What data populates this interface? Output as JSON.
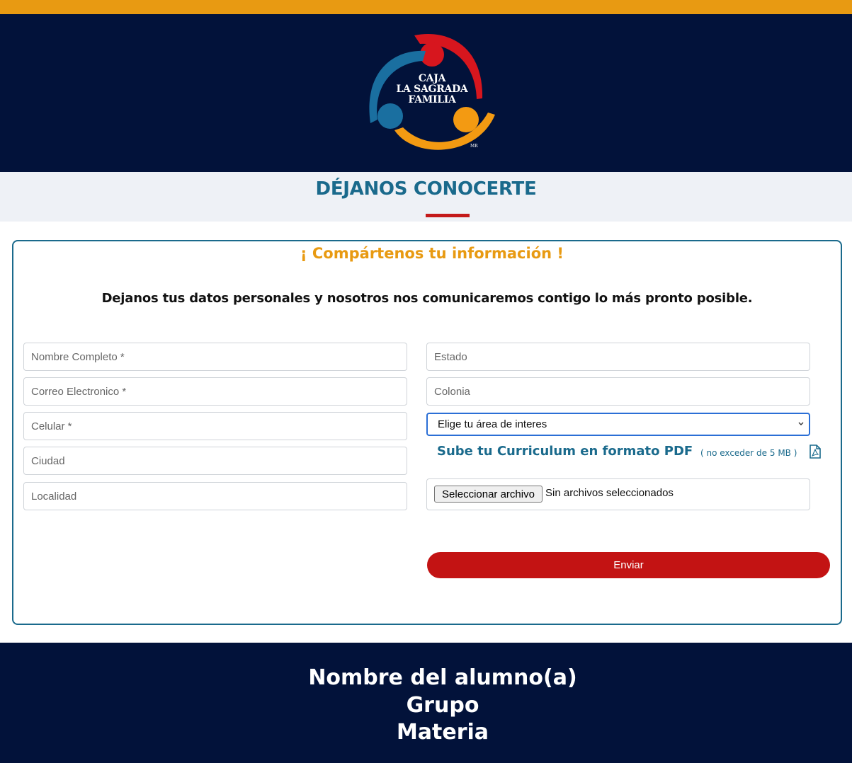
{
  "header": {
    "logo_lines": [
      "CAJA",
      "LA SAGRADA",
      "FAMILIA"
    ],
    "logo_mark": "MR",
    "colors": {
      "top_bar": "#e89a12",
      "navy": "#02123a",
      "logo_red": "#d7161e",
      "logo_blue": "#1a6fa0",
      "logo_orange": "#f39a12"
    }
  },
  "section": {
    "title": "DÉJANOS CONOCERTE",
    "accent": "#c41a1a"
  },
  "form": {
    "heading": "¡ Compártenos tu información !",
    "subtitle": "Dejanos tus datos personales y nosotros nos comunicaremos contigo lo más pronto posible.",
    "left_fields": [
      {
        "placeholder": "Nombre Completo *"
      },
      {
        "placeholder": "Correo Electronico *"
      },
      {
        "placeholder": "Celular *"
      },
      {
        "placeholder": "Ciudad"
      },
      {
        "placeholder": "Localidad"
      }
    ],
    "right_fields": [
      {
        "placeholder": "Estado"
      },
      {
        "placeholder": "Colonia"
      }
    ],
    "area_select": {
      "value": "Elige tu área de interes"
    },
    "upload": {
      "label": "Sube tu Curriculum en formato PDF",
      "note": "( no exceder de 5 MB )",
      "icon": "pdf-icon",
      "button": "Seleccionar archivo",
      "status": "Sin archivos seleccionados"
    },
    "submit_label": "Enviar"
  },
  "footer": {
    "lines": [
      "Nombre del alumno(a)",
      "Grupo",
      "Materia"
    ]
  }
}
